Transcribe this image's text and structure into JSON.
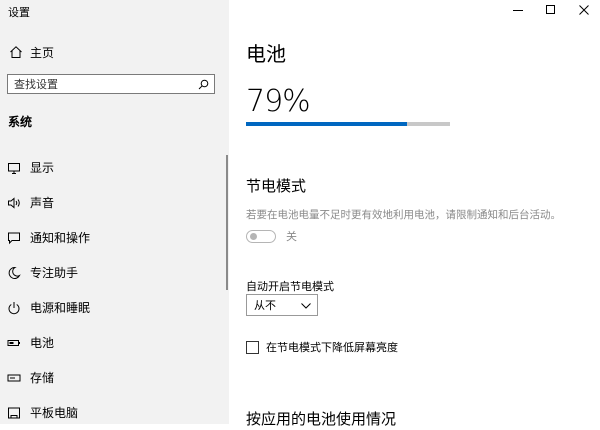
{
  "window": {
    "title": "设置",
    "controls": [
      "minimize-icon",
      "maximize-icon",
      "close-icon"
    ]
  },
  "sidebar": {
    "home": {
      "icon": "home-icon",
      "label": "主页"
    },
    "search": {
      "placeholder": "查找设置",
      "icon": "search-icon"
    },
    "section": "系统",
    "items": [
      {
        "icon": "display-icon",
        "label": "显示"
      },
      {
        "icon": "sound-icon",
        "label": "声音"
      },
      {
        "icon": "notification-icon",
        "label": "通知和操作"
      },
      {
        "icon": "focus-assist-icon",
        "label": "专注助手"
      },
      {
        "icon": "power-icon",
        "label": "电源和睡眠"
      },
      {
        "icon": "battery-icon",
        "label": "电池"
      },
      {
        "icon": "storage-icon",
        "label": "存储"
      },
      {
        "icon": "tablet-icon",
        "label": "平板电脑"
      }
    ]
  },
  "main": {
    "title": "电池",
    "battery_percent_text": "79%",
    "battery_level": 0.79,
    "accent_color": "#0067c0",
    "saver": {
      "heading": "节电模式",
      "description": "若要在电池电量不足时更有效地利用电池，请限制通知和后台活动。",
      "toggle_state_label": "关",
      "auto_on_label": "自动开启节电模式",
      "auto_on_value": "从不",
      "lower_brightness_label": "在节电模式下降低屏幕亮度",
      "lower_brightness_checked": false
    },
    "usage_heading": "按应用的电池使用情况"
  }
}
